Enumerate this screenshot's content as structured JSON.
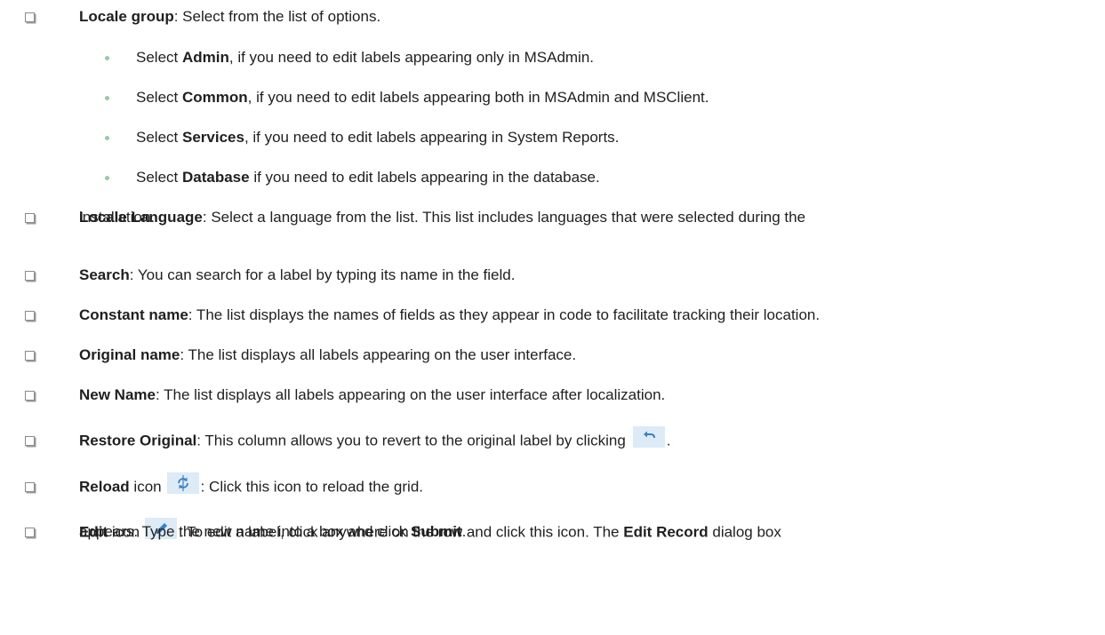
{
  "locale_group": {
    "term": "Locale group",
    "desc": ": Select from the list of options.",
    "options": [
      {
        "pre": "Select ",
        "term": "Admin",
        "desc": ", if you need to edit labels appearing only in MSAdmin."
      },
      {
        "pre": "Select ",
        "term": "Common",
        "desc": ", if you need to edit labels appearing both in MSAdmin and MSClient."
      },
      {
        "pre": "Select ",
        "term": "Services",
        "desc": ", if you need to edit labels appearing in System Reports."
      },
      {
        "pre": "Select ",
        "term": "Database",
        "desc": " if you need to edit labels appearing in the database."
      }
    ]
  },
  "locale_language": {
    "term": "Locale Language",
    "desc_line1": ": Select a language from the list. This list includes languages that were selected during the",
    "desc_line2": "installation."
  },
  "search": {
    "term": "Search",
    "desc": ": You can search for a label by typing its name in the field."
  },
  "constant_name": {
    "term": "Constant name",
    "desc": ": The list displays the names of fields as they appear in code to facilitate tracking their location."
  },
  "original_name": {
    "term": "Original name",
    "desc": ": The list displays all labels appearing on the user interface."
  },
  "new_name": {
    "term": "New Name",
    "desc": ": The list displays all labels appearing on the user interface after localization."
  },
  "restore_original": {
    "term": "Restore Original",
    "desc": ": This column allows you to revert to the original label by clicking",
    "end": ".",
    "icon": "undo-icon"
  },
  "reload": {
    "term": "Reload",
    "word": " icon",
    "desc": ": Click this icon to reload the grid.",
    "icon": "reload-icon"
  },
  "edit": {
    "term": "Edit",
    "word": " icon",
    "desc1": ": To edit a label, click anywhere on the row and click this icon. The ",
    "term2": "Edit Record",
    "desc2": " dialog box",
    "line2_pre": "appears. Type the new name into a box and click ",
    "term3": "Submit",
    "line2_end": ".",
    "icon": "pencil-icon"
  },
  "colors": {
    "icon_tile_bg": "#dcebf6",
    "icon_fg": "#3b7fc0",
    "bullet_dot": "#9ac8a6"
  }
}
